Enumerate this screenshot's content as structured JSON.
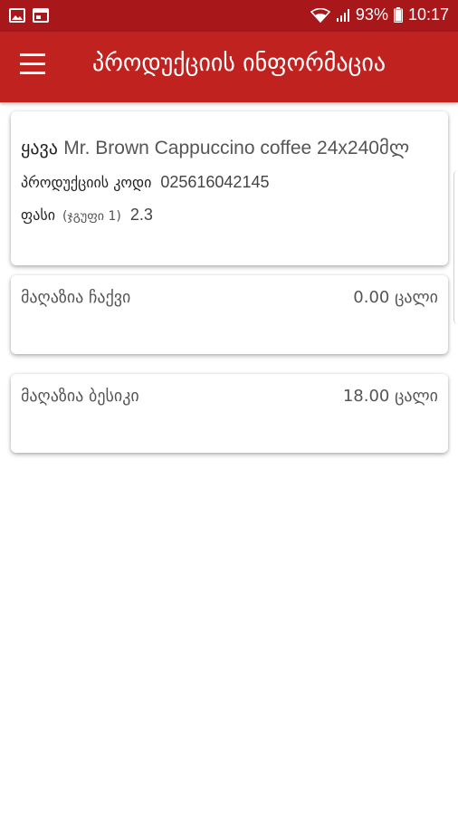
{
  "status_bar": {
    "battery": "93%",
    "time": "10:17"
  },
  "app_bar": {
    "title": "პროდუქციის ინფორმაცია"
  },
  "product": {
    "category": "ყავა",
    "model": "Mr. Brown Cappuccino coffee 24x240მლ",
    "code_label": "პროდუქციის კოდი",
    "code_value": "025616042145",
    "price_label": "ფასი",
    "price_group": "(ჯგუფი 1)",
    "price_value": "2.3"
  },
  "stores": [
    {
      "name": "მაღაზია ჩაქვი",
      "quantity": "0.00 ცალი"
    },
    {
      "name": "მაღაზია ბესიკი",
      "quantity": "18.00 ცალი"
    }
  ]
}
